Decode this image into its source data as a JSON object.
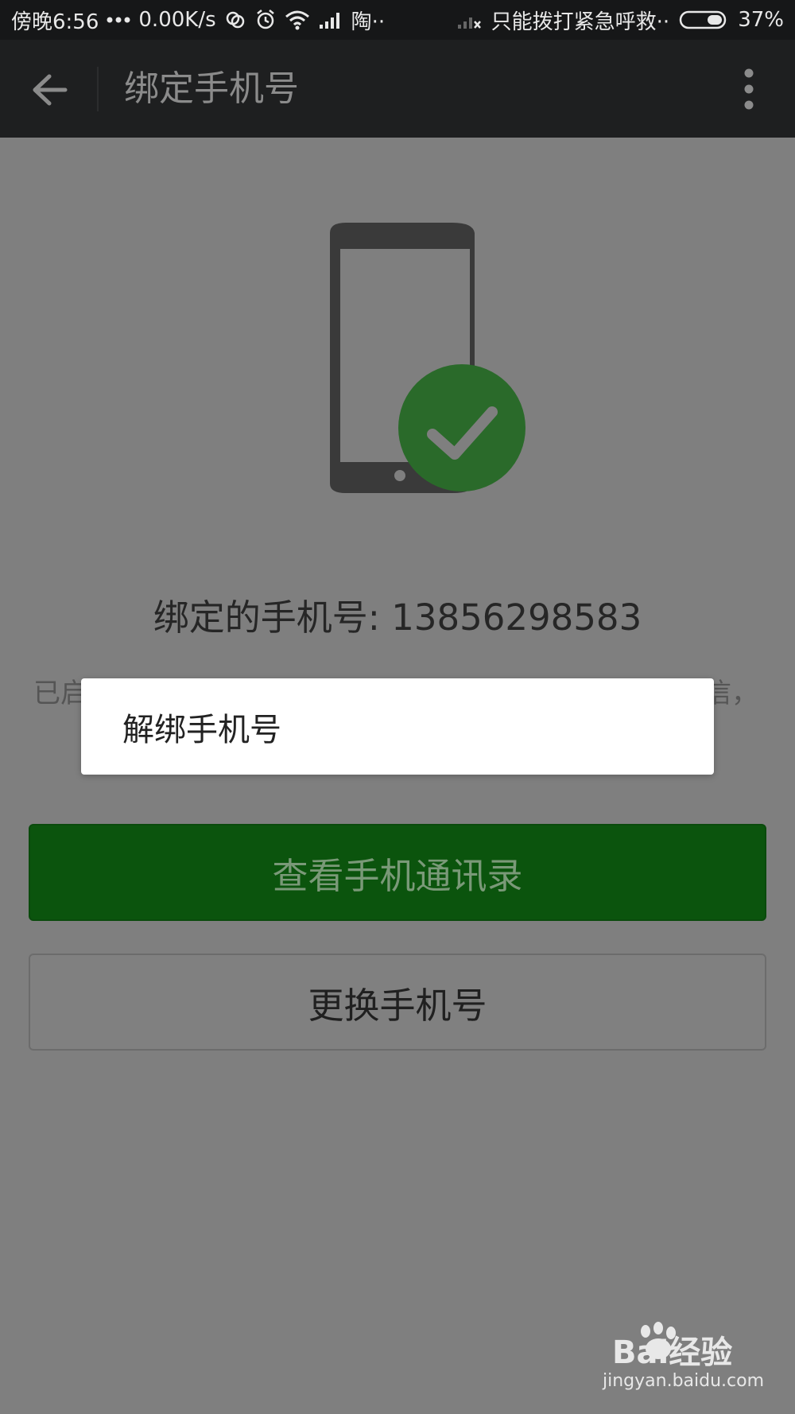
{
  "status_bar": {
    "time": "傍晚6:56",
    "net_speed": "0.00K/s",
    "carrier1": "陶··",
    "carrier2": "只能拨打紧急呼救··",
    "battery": "37%"
  },
  "app_bar": {
    "title": "绑定手机号"
  },
  "content": {
    "bound_number_label": "绑定的手机号: 13856298583",
    "desc_left": "已启",
    "desc_right": "信，"
  },
  "buttons": {
    "view_contacts": "查看手机通讯录",
    "change_number": "更换手机号"
  },
  "popup": {
    "unbind_label": "解绑手机号"
  },
  "watermark": {
    "brand": "Bai经验",
    "url": "jingyan.baidu.com"
  },
  "colors": {
    "status_bar_bg": "#161718",
    "app_bar_bg": "#1e1f20",
    "dim_background": "#7f7f7f",
    "primary_green": "#0b540d",
    "check_green": "#2a6a2a"
  }
}
